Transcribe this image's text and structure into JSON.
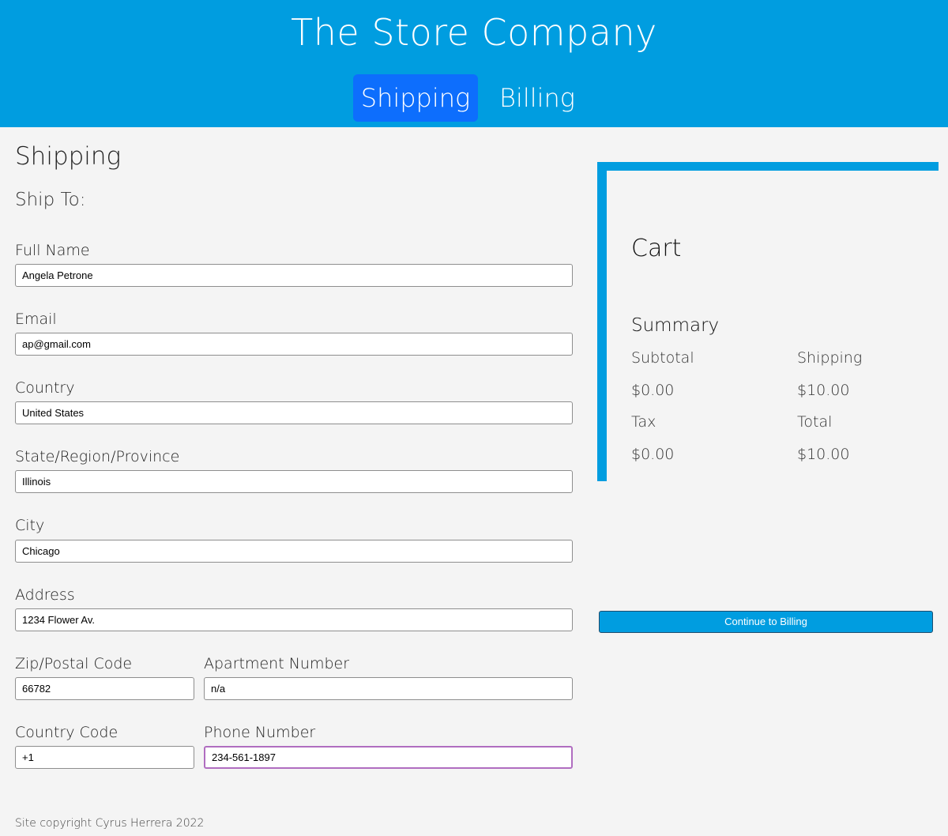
{
  "header": {
    "title": "The Store Company",
    "tabs": [
      {
        "label": "Shipping",
        "active": true
      },
      {
        "label": "Billing",
        "active": false
      }
    ],
    "bg_color": "#009de0",
    "active_tab_color": "#0d6efd"
  },
  "form": {
    "heading": "Shipping",
    "subheading": "Ship To:",
    "fields": {
      "full_name": {
        "label": "Full Name",
        "value": "Angela Petrone"
      },
      "email": {
        "label": "Email",
        "value": "ap@gmail.com"
      },
      "country": {
        "label": "Country",
        "value": "United States"
      },
      "state": {
        "label": "State/Region/Province",
        "value": "Illinois"
      },
      "city": {
        "label": "City",
        "value": "Chicago"
      },
      "address": {
        "label": "Address",
        "value": "1234 Flower Av."
      },
      "zip": {
        "label": "Zip/Postal Code",
        "value": "66782"
      },
      "apartment": {
        "label": "Apartment Number",
        "value": "n/a"
      },
      "country_code": {
        "label": "Country Code",
        "value": "+1"
      },
      "phone": {
        "label": "Phone Number",
        "value": "234-561-1897"
      }
    }
  },
  "cart": {
    "title": "Cart",
    "summary_title": "Summary",
    "subtotal_label": "Subtotal",
    "subtotal_value": "$0.00",
    "shipping_label": "Shipping",
    "shipping_value": "$10.00",
    "tax_label": "Tax",
    "tax_value": "$0.00",
    "total_label": "Total",
    "total_value": "$10.00",
    "continue_label": "Continue to Billing"
  },
  "footer": {
    "text": "Site copyright Cyrus Herrera 2022"
  }
}
